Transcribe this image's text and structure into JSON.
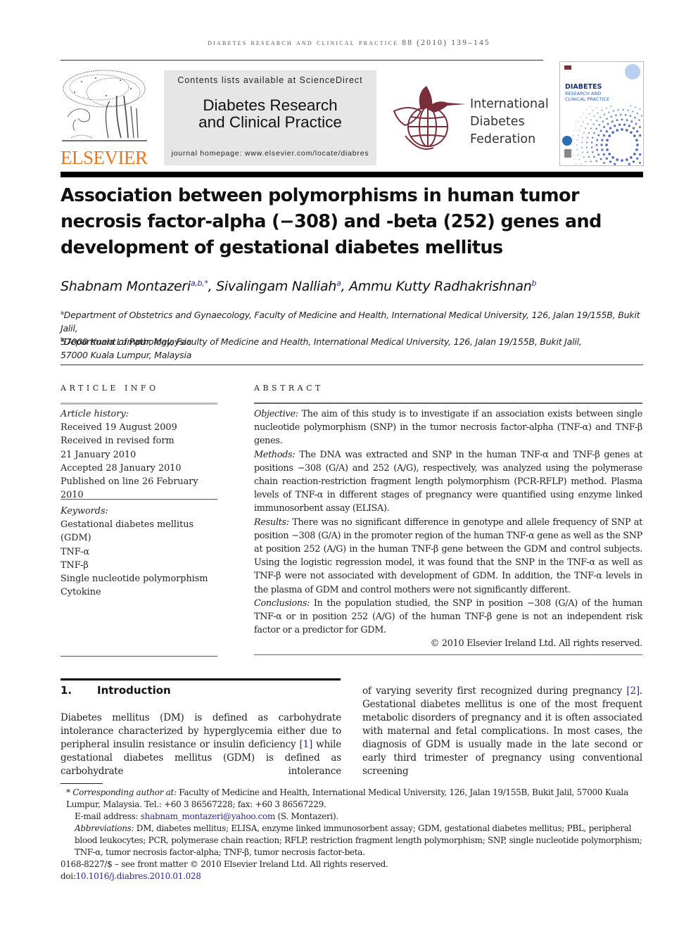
{
  "running_header": "diabetes research and clinical practice 88 (2010) 139–145",
  "publisher": {
    "name": "ELSEVIER",
    "brand_color": "#e87722"
  },
  "journal_box": {
    "contents_line": "Contents lists available at ScienceDirect",
    "journal_title_line1": "Diabetes Research",
    "journal_title_line2": "and Clinical Practice",
    "homepage": "journal homepage: www.elsevier.com/locate/diabres",
    "background_color": "#e6e6e6"
  },
  "idf": {
    "line1": "International",
    "line2": "Diabetes",
    "line3": "Federation",
    "brand_color": "#7a2e3c"
  },
  "cover": {
    "title1": "DIABETES",
    "title2": "RESEARCH AND",
    "title3": "CLINICAL PRACTICE"
  },
  "article": {
    "title": "Association between polymorphisms in human tumor necrosis factor-alpha (−308) and -beta (252) genes and development of gestational diabetes mellitus",
    "authors": [
      {
        "name": "Shabnam Montazeri",
        "sup": "a,b,*"
      },
      {
        "name": "Sivalingam Nalliah",
        "sup": "a"
      },
      {
        "name": "Ammu Kutty Radhakrishnan",
        "sup": "b"
      }
    ],
    "affiliations": [
      {
        "mark": "a",
        "line1": "Department of Obstetrics and Gynaecology, Faculty of Medicine and Health, International Medical University, 126, Jalan 19/155B, Bukit Jalil,",
        "line2": "57000 Kuala Lumpur, Malaysia"
      },
      {
        "mark": "b",
        "line1": "Department of Pathology, Faculty of Medicine and Health, International Medical University, 126, Jalan 19/155B, Bukit Jalil,",
        "line2": "57000 Kuala Lumpur, Malaysia"
      }
    ]
  },
  "article_info": {
    "heading": "ARTICLE INFO",
    "history_label": "Article history:",
    "history": [
      "Received 19 August 2009",
      "Received in revised form",
      "21 January 2010",
      "Accepted 28 January 2010",
      "Published on line 26 February 2010"
    ],
    "keywords_label": "Keywords:",
    "keywords": [
      "Gestational diabetes mellitus (GDM)",
      "TNF-α",
      "TNF-β",
      "Single nucleotide polymorphism",
      "Cytokine"
    ]
  },
  "abstract": {
    "heading": "ABSTRACT",
    "sections": [
      {
        "label": "Objective:",
        "text": "The aim of this study is to investigate if an association exists between single nucleotide polymorphism (SNP) in the tumor necrosis factor-alpha (TNF-α) and TNF-β genes."
      },
      {
        "label": "Methods:",
        "text": "The DNA was extracted and SNP in the human TNF-α and TNF-β genes at positions −308 (G/A) and 252 (A/G), respectively, was analyzed using the polymerase chain reaction-restriction fragment length polymorphism (PCR-RFLP) method. Plasma levels of TNF-α in different stages of pregnancy were quantified using enzyme linked immunosorbent assay (ELISA)."
      },
      {
        "label": "Results:",
        "text": "There was no significant difference in genotype and allele frequency of SNP at position −308 (G/A) in the promoter region of the human TNF-α gene as well as the SNP at position 252 (A/G) in the human TNF-β gene between the GDM and control subjects. Using the logistic regression model, it was found that the SNP in the TNF-α as well as TNF-β were not associated with development of GDM. In addition, the TNF-α levels in the plasma of GDM and control mothers were not significantly different."
      },
      {
        "label": "Conclusions:",
        "text": "In the population studied, the SNP in position −308 (G/A) of the human TNF-α or in position 252 (A/G) of the human TNF-β gene is not an independent risk factor or a predictor for GDM."
      }
    ],
    "copyright": "© 2010 Elsevier Ireland Ltd. All rights reserved."
  },
  "introduction": {
    "number": "1.",
    "heading": "Introduction",
    "col1_before_ref": "Diabetes mellitus (DM) is defined as carbohydrate intolerance characterized by hyperglycemia either due to peripheral insulin resistance or insulin deficiency ",
    "col1_ref": "[1]",
    "col1_after_ref": " while gestational diabetes mellitus (GDM) is defined as carbohydrate intolerance",
    "col2_before_ref": "of varying severity first recognized during pregnancy ",
    "col2_ref": "[2]",
    "col2_after_ref": ". Gestational diabetes mellitus is one of the most frequent metabolic disorders of pregnancy and it is often associated with maternal and fetal complications. In most cases, the diagnosis of GDM is usually made in the late second or early third trimester of pregnancy using conventional screening"
  },
  "footnotes": {
    "corresponding_label": "Corresponding author at:",
    "corresponding_text": "Faculty of Medicine and Health, International Medical University, 126, Jalan 19/155B, Bukit Jalil, 57000 Kuala Lumpur, Malaysia. Tel.: +60 3 86567228; fax: +60 3 86567229.",
    "email_label": "E-mail address:",
    "email": "shabnam_montazeri@yahoo.com",
    "email_suffix": "(S. Montazeri).",
    "abbrev_label": "Abbreviations:",
    "abbrev_text": "DM, diabetes mellitus; ELISA, enzyme linked immunosorbent assay; GDM, gestational diabetes mellitus; PBL, peripheral blood leukocytes; PCR, polymerase chain reaction; RFLP, restriction fragment length polymorphism; SNP, single nucleotide polymorphism; TNF-α, tumor necrosis factor-alpha; TNF-β, tumor necrosis factor-beta.",
    "front_matter": "0168-8227/$ – see front matter © 2010 Elsevier Ireland Ltd. All rights reserved.",
    "doi_label": "doi:",
    "doi": "10.1016/j.diabres.2010.01.028"
  }
}
